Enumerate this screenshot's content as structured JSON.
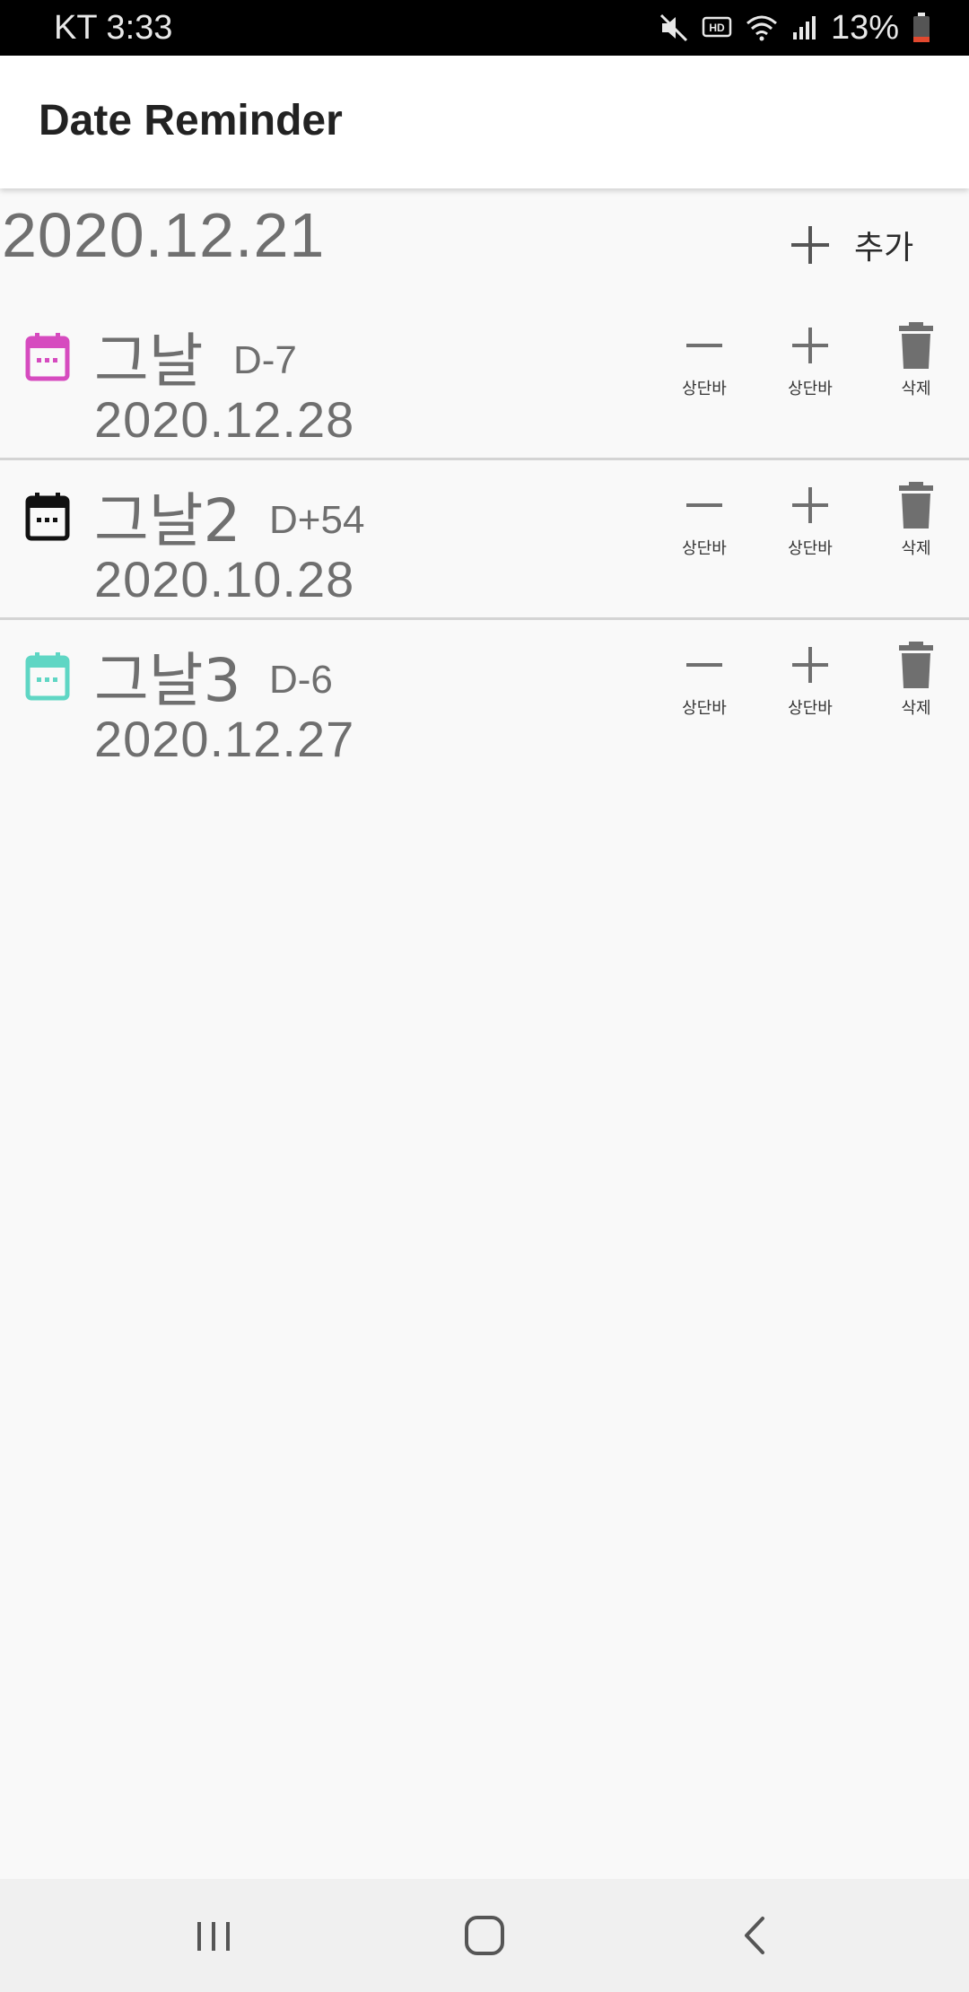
{
  "status_bar": {
    "carrier_time": "KT 3:33",
    "battery": "13%",
    "icons": [
      "mute-icon",
      "hd-icon",
      "wifi-icon",
      "signal-icon",
      "battery-icon"
    ]
  },
  "app_bar": {
    "title": "Date Reminder"
  },
  "header": {
    "today": "2020.12.21",
    "add_label": "추가"
  },
  "items": [
    {
      "name": "그날",
      "dday": "D-7",
      "date": "2020.12.28",
      "icon_color": "#d64bbf",
      "minus_label": "상단바",
      "plus_label": "상단바",
      "delete_label": "삭제"
    },
    {
      "name": "그날2",
      "dday": "D+54",
      "date": "2020.10.28",
      "icon_color": "#111111",
      "minus_label": "상단바",
      "plus_label": "상단바",
      "delete_label": "삭제"
    },
    {
      "name": "그날3",
      "dday": "D-6",
      "date": "2020.12.27",
      "icon_color": "#5fd6c4",
      "minus_label": "상단바",
      "plus_label": "상단바",
      "delete_label": "삭제"
    }
  ],
  "nav_bar": {
    "icons": [
      "recent-apps-icon",
      "home-icon",
      "back-icon"
    ]
  }
}
